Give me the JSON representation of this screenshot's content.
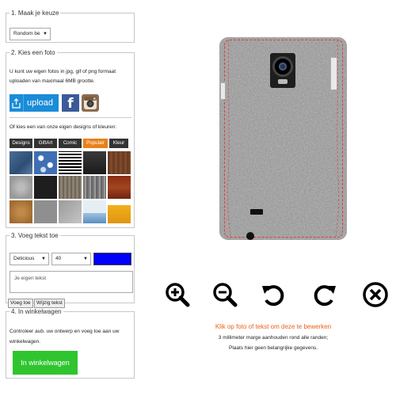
{
  "step1": {
    "legend": "1. Maak je keuze",
    "select_value": "Rondom be"
  },
  "step2": {
    "legend": "2. Kies een foto",
    "intro": "U kunt uw eigen fotos in jpg, gif of png formaat uploaden van maximaal 6MB grootte.",
    "upload_label": "upload",
    "facebook_label": "f",
    "own_designs_label": "Of kies een van onze eigen designs of kleuren:",
    "tabs": [
      {
        "label": "Designs",
        "active": false
      },
      {
        "label": "GiftArt",
        "active": false
      },
      {
        "label": "Comic",
        "active": false
      },
      {
        "label": "Populair",
        "active": true
      },
      {
        "label": "Kleur",
        "active": false
      }
    ],
    "designs": [
      "denim-blue",
      "blue-flowers",
      "stripes",
      "dark-wood",
      "brown-wood",
      "grey-granite",
      "black-stone",
      "wood-panel",
      "bark",
      "red-wood",
      "cork",
      "grey-leather",
      "metal-grey",
      "sea-wave",
      "beer-glass"
    ]
  },
  "step3": {
    "legend": "3. Voeg tekst toe",
    "font_value": "Delicious",
    "size_value": "40",
    "text_placeholder": "Je eigen tekst",
    "add_button": "Voeg toe",
    "edit_button": "Wijzig tekst",
    "text_color": "#0000ff"
  },
  "step4": {
    "legend": "4. In winkelwagen",
    "text": "Controleer aub. uw ontwerp en voeg toe aan uw winkelwagen.",
    "cart_button": "In winkelwagen"
  },
  "preview": {
    "cut_line_color": "#e53b3b",
    "hint_primary": "Klik op foto of tekst om deze te bewerken",
    "hint_margin": "3 millimeter marge aanhouden rond alle randen;",
    "hint_info": "Plaats hier geen belangrijke gegevens."
  },
  "tools": [
    "zoom-in-icon",
    "zoom-out-icon",
    "rotate-left-icon",
    "rotate-right-icon",
    "delete-icon"
  ],
  "colors": {
    "accent_orange": "#e8811b",
    "upload_blue": "#1a8cd8",
    "cart_green": "#2fc52f",
    "facebook_blue": "#3b5a9a"
  }
}
